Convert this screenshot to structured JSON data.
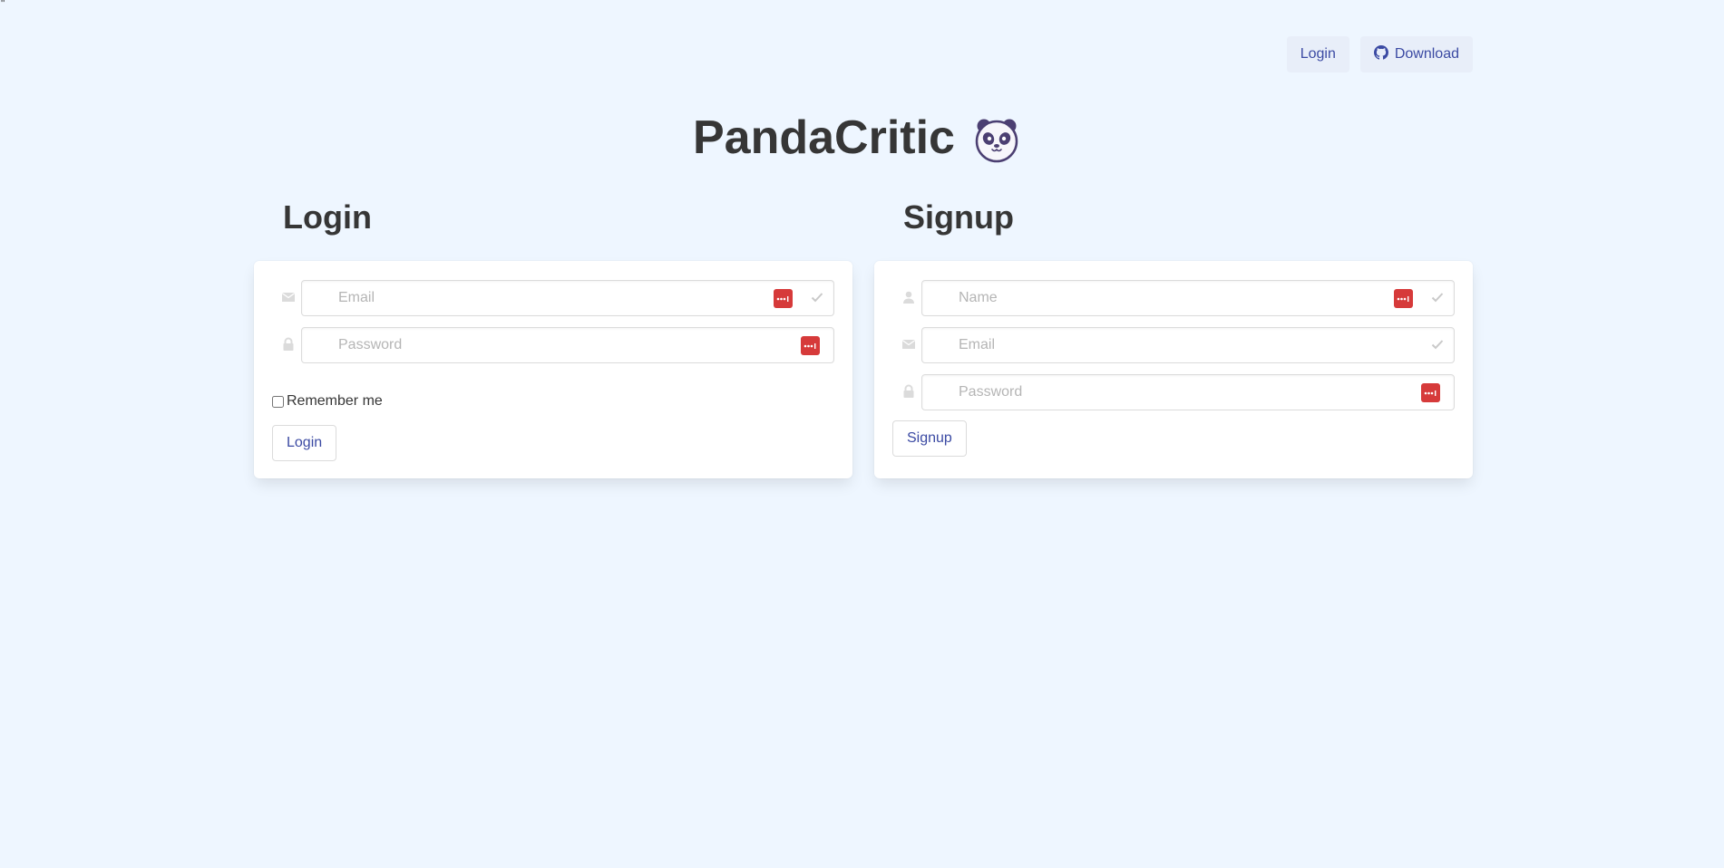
{
  "stray_mark": "\"",
  "nav": {
    "login_label": "Login",
    "download_label": "Download",
    "download_icon": "github-icon"
  },
  "brand": {
    "title": "PandaCritic",
    "logo_icon": "panda-icon"
  },
  "login": {
    "heading": "Login",
    "email_placeholder": "Email",
    "password_placeholder": "Password",
    "remember_label": "Remember me",
    "remember_checked": false,
    "submit_label": "Login"
  },
  "signup": {
    "heading": "Signup",
    "name_placeholder": "Name",
    "email_placeholder": "Email",
    "password_placeholder": "Password",
    "submit_label": "Signup"
  },
  "colors": {
    "background": "#eef6ff",
    "accent_text": "#3b4aa3",
    "password_manager_badge": "#d63a3a",
    "input_border": "#dbdbdb"
  }
}
